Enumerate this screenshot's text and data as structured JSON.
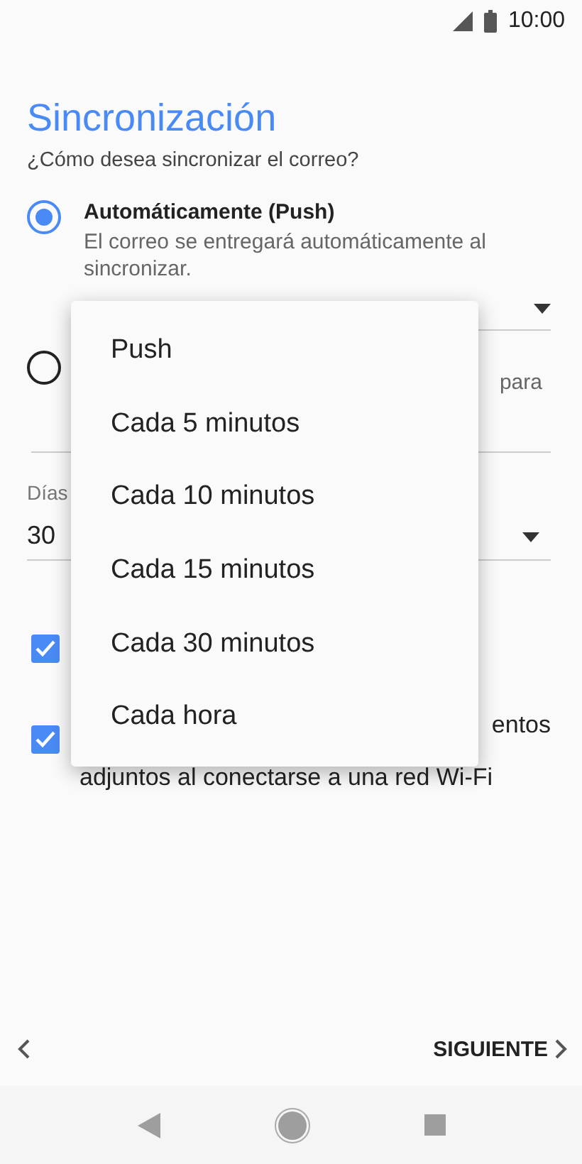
{
  "status_bar": {
    "time": "10:00"
  },
  "title": "Sincronización",
  "subtitle": "¿Cómo desea sincronizar el correo?",
  "sync_options": [
    {
      "label": "Automáticamente (Push)",
      "description": "El correo se entregará automáticamente al sincronizar.",
      "selected": true
    },
    {
      "description_fragment": "para",
      "selected": false
    }
  ],
  "days_field": {
    "label": "Días",
    "value": "30"
  },
  "checkboxes": [
    {
      "checked": true
    },
    {
      "line_1": "entos",
      "line_2": "adjuntos al conectarse a una red Wi-Fi",
      "checked": true
    }
  ],
  "dropdown_menu": {
    "items": [
      "Push",
      "Cada 5 minutos",
      "Cada 10 minutos",
      "Cada 15 minutos",
      "Cada 30 minutos",
      "Cada hora"
    ]
  },
  "footer": {
    "next": "SIGUIENTE"
  }
}
